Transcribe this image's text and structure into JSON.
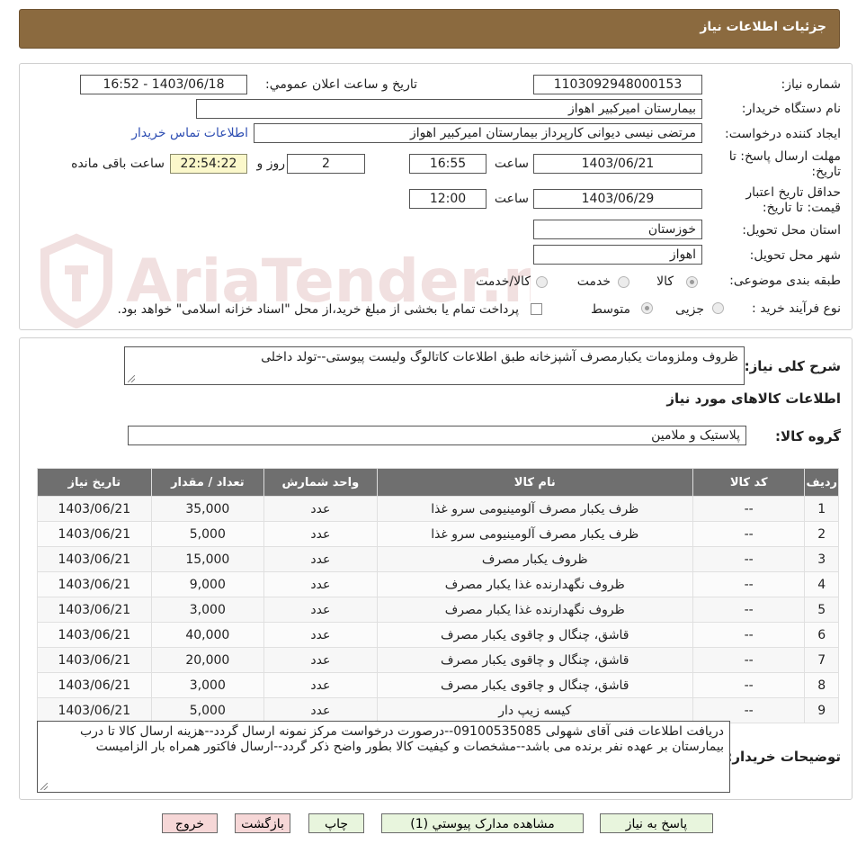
{
  "header": {
    "title": "جزئیات اطلاعات نیاز"
  },
  "form": {
    "need_number": {
      "label": "شماره نیاز:",
      "value": "1103092948000153"
    },
    "announce_datetime": {
      "label": "تاريخ و ساعت اعلان عمومي:",
      "value": "1403/06/18 - 16:52"
    },
    "buyer_org": {
      "label": "نام دستگاه خریدار:",
      "value": "بیمارستان امیرکبیر اهواز"
    },
    "requester": {
      "label": "ایجاد کننده درخواست:",
      "value": "مرتضی نیسی دیوانی کارپرداز بیمارستان امیرکبیر اهواز",
      "contact_link": "اطلاعات تماس خریدار"
    },
    "deadline": {
      "label_line1": "مهلت ارسال پاسخ: تا",
      "label_line2": "تاریخ:",
      "date": "1403/06/21",
      "time_label": "ساعت",
      "time": "16:55",
      "days": "2",
      "days_label": "روز و",
      "remaining": "22:54:22",
      "remaining_label": "ساعت باقی مانده"
    },
    "price_validity": {
      "label_line1": "حداقل تاریخ اعتبار",
      "label_line2": "قیمت: تا تاریخ:",
      "date": "1403/06/29",
      "time_label": "ساعت",
      "time": "12:00"
    },
    "province": {
      "label": "استان محل تحویل:",
      "value": "خوزستان"
    },
    "city": {
      "label": "شهر محل تحویل:",
      "value": "اهواز"
    },
    "category": {
      "label": "طبقه بندی موضوعی:",
      "options": [
        "کالا",
        "خدمت",
        "کالا/خدمت"
      ],
      "selected": "کالا"
    },
    "process": {
      "label": "نوع فرآیند خرید :",
      "options": [
        "جزیی",
        "متوسط"
      ],
      "selected": "متوسط",
      "payment_note": "پرداخت تمام یا بخشی از مبلغ خرید،از محل \"اسناد خزانه اسلامی\" خواهد بود."
    }
  },
  "summary": {
    "label": "شرح کلی نیاز:",
    "value": "ظروف وملزومات یکبارمصرف آشپزخانه طبق اطلاعات کاتالوگ ولیست پیوستی--تولد داخلی"
  },
  "items_section": {
    "title": "اطلاعات کالاهای مورد نیاز",
    "group_label": "گروه کالا:",
    "group_value": "پلاستیک و ملامین",
    "columns": [
      "ردیف",
      "کد کالا",
      "نام کالا",
      "واحد شمارش",
      "تعداد / مقدار",
      "تاریخ نیاز"
    ],
    "rows": [
      {
        "row": "1",
        "code": "--",
        "name": "ظرف یکبار مصرف آلومینیومی سرو غذا",
        "unit": "عدد",
        "qty": "35,000",
        "date": "1403/06/21"
      },
      {
        "row": "2",
        "code": "--",
        "name": "ظرف یکبار مصرف آلومینیومی سرو غذا",
        "unit": "عدد",
        "qty": "5,000",
        "date": "1403/06/21"
      },
      {
        "row": "3",
        "code": "--",
        "name": "ظروف یکبار مصرف",
        "unit": "عدد",
        "qty": "15,000",
        "date": "1403/06/21"
      },
      {
        "row": "4",
        "code": "--",
        "name": "ظروف نگهدارنده غذا یکبار مصرف",
        "unit": "عدد",
        "qty": "9,000",
        "date": "1403/06/21"
      },
      {
        "row": "5",
        "code": "--",
        "name": "ظروف نگهدارنده غذا یکبار مصرف",
        "unit": "عدد",
        "qty": "3,000",
        "date": "1403/06/21"
      },
      {
        "row": "6",
        "code": "--",
        "name": "قاشق، چنگال و چاقوی یکبار مصرف",
        "unit": "عدد",
        "qty": "40,000",
        "date": "1403/06/21"
      },
      {
        "row": "7",
        "code": "--",
        "name": "قاشق، چنگال و چاقوی یکبار مصرف",
        "unit": "عدد",
        "qty": "20,000",
        "date": "1403/06/21"
      },
      {
        "row": "8",
        "code": "--",
        "name": "قاشق، چنگال و چاقوی یکبار مصرف",
        "unit": "عدد",
        "qty": "3,000",
        "date": "1403/06/21"
      },
      {
        "row": "9",
        "code": "--",
        "name": "کیسه زیپ دار",
        "unit": "عدد",
        "qty": "5,000",
        "date": "1403/06/21"
      }
    ]
  },
  "buyer_notes": {
    "label": "توضیحات خریدار:",
    "value": "دریافت اطلاعات فنی آقای شهولی 09100535085--درصورت درخواست مرکز نمونه ارسال گردد--هزینه ارسال کالا تا درب بیمارستان بر عهده نفر برنده می باشد--مشخصات و کیفیت کالا بطور واضح ذکر گردد--ارسال فاکتور همراه بار الزامیست"
  },
  "buttons": {
    "reply": "پاسخ به نیاز",
    "attachments": "مشاهده مدارک پیوستي (1)",
    "print": "چاپ",
    "back": "بازگشت",
    "exit": "خروج"
  },
  "watermark": {
    "text": "AriaTender.neT"
  },
  "colors": {
    "header_bg": "#8b6a3f",
    "table_header_bg": "#6f6f6f",
    "link": "#2f4fb3",
    "remaining_bg": "#fbf8cb"
  }
}
